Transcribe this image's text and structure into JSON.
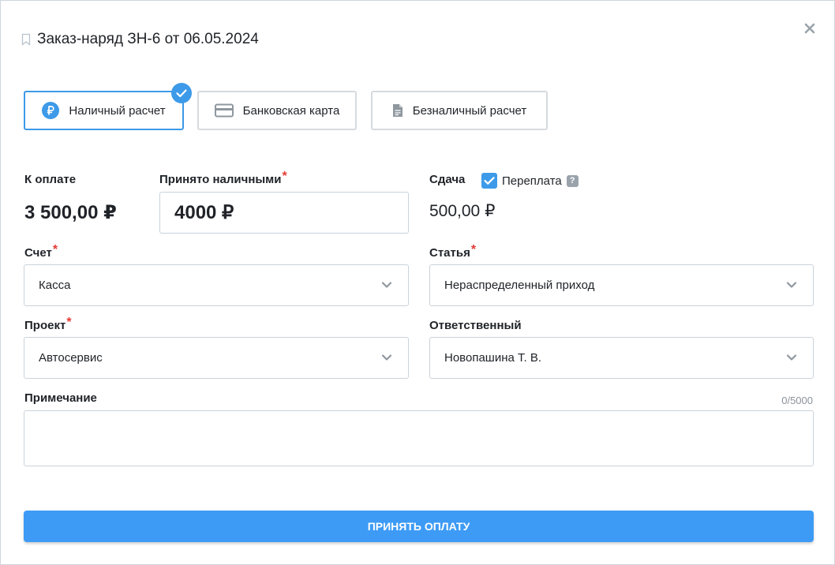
{
  "dialog": {
    "title": "Заказ-наряд ЗН-6 от 06.05.2024",
    "payment_methods": [
      {
        "label": "Наличный расчет",
        "icon": "ruble-circle-icon",
        "selected": true
      },
      {
        "label": "Банковская карта",
        "icon": "credit-card-icon",
        "selected": false
      },
      {
        "label": "Безналичный расчет",
        "icon": "document-icon",
        "selected": false
      }
    ],
    "to_pay": {
      "label": "К оплате",
      "value": "3 500,00 ₽"
    },
    "cash_received": {
      "label": "Принято наличными",
      "value": "4000 ₽"
    },
    "change": {
      "label": "Сдача",
      "value": "500,00 ₽"
    },
    "overpayment": {
      "label": "Переплата",
      "checked": true,
      "help": "?"
    },
    "account": {
      "label": "Счет",
      "value": "Касса"
    },
    "article": {
      "label": "Статья",
      "value": "Нераспределенный приход"
    },
    "project": {
      "label": "Проект",
      "value": "Автосервис"
    },
    "responsible": {
      "label": "Ответственный",
      "value": "Новопашина Т. В."
    },
    "note": {
      "label": "Примечание",
      "value": "",
      "counter": "0/5000"
    },
    "submit_label": "ПРИНЯТЬ ОПЛАТУ",
    "required_mark": "*"
  },
  "colors": {
    "accent": "#3d9ae8",
    "required": "#e53935",
    "border": "#c9d2da"
  }
}
